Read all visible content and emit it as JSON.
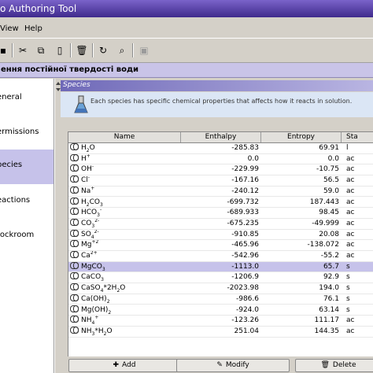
{
  "window": {
    "title": "o Authoring Tool"
  },
  "menu": [
    {
      "label": "View"
    },
    {
      "label": "Help"
    }
  ],
  "document_bar": {
    "title": "ення постійної твердості води"
  },
  "sidebar": {
    "items": [
      {
        "label": "eneral",
        "selected": false
      },
      {
        "label": "ermissions",
        "selected": false
      },
      {
        "label": "pecies",
        "selected": true
      },
      {
        "label": "eactions",
        "selected": false
      },
      {
        "label": "tockroom",
        "selected": false
      }
    ]
  },
  "section": {
    "title": "Species",
    "info": "Each species has specific chemical properties that affects how it reacts in solution."
  },
  "table": {
    "columns": [
      "Name",
      "Enthalpy",
      "Entropy",
      "Sta"
    ],
    "rows": [
      {
        "name": "H<sub>2</sub>O",
        "enthalpy": "-285.83",
        "entropy": "69.91",
        "state": "l"
      },
      {
        "name": "H<sup>+</sup>",
        "enthalpy": "0.0",
        "entropy": "0.0",
        "state": "ac"
      },
      {
        "name": "OH<sup>-</sup>",
        "enthalpy": "-229.99",
        "entropy": "-10.75",
        "state": "ac"
      },
      {
        "name": "Cl<sup>-</sup>",
        "enthalpy": "-167.16",
        "entropy": "56.5",
        "state": "ac"
      },
      {
        "name": "Na<sup>+</sup>",
        "enthalpy": "-240.12",
        "entropy": "59.0",
        "state": "ac"
      },
      {
        "name": "H<sub>2</sub>CO<sub>3</sub>",
        "enthalpy": "-699.732",
        "entropy": "187.443",
        "state": "ac"
      },
      {
        "name": "HCO<sub>3</sub><sup>-</sup>",
        "enthalpy": "-689.933",
        "entropy": "98.45",
        "state": "ac"
      },
      {
        "name": "CO<sub>3</sub><sup>2-</sup>",
        "enthalpy": "-675.235",
        "entropy": "-49.999",
        "state": "ac"
      },
      {
        "name": "SO<sub>4</sub><sup>2-</sup>",
        "enthalpy": "-910.85",
        "entropy": "20.08",
        "state": "ac"
      },
      {
        "name": "Mg<sup>+2</sup>",
        "enthalpy": "-465.96",
        "entropy": "-138.072",
        "state": "ac"
      },
      {
        "name": "Ca<sup>2+</sup>",
        "enthalpy": "-542.96",
        "entropy": "-55.2",
        "state": "ac"
      },
      {
        "name": "MgCO<sub>3</sub>",
        "enthalpy": "-1113.0",
        "entropy": "65.7",
        "state": "s"
      },
      {
        "name": "CaCO<sub>3</sub>",
        "enthalpy": "-1206.9",
        "entropy": "92.9",
        "state": "s"
      },
      {
        "name": "CaSO<sub>4</sub>*2H<sub>2</sub>O",
        "enthalpy": "-2023.98",
        "entropy": "194.0",
        "state": "s"
      },
      {
        "name": "Ca(OH)<sub>2</sub>",
        "enthalpy": "-986.6",
        "entropy": "76.1",
        "state": "s"
      },
      {
        "name": "Mg(OH)<sub>2</sub>",
        "enthalpy": "-924.0",
        "entropy": "63.14",
        "state": "s"
      },
      {
        "name": "NH<sub>4</sub><sup>+</sup>",
        "enthalpy": "-123.26",
        "entropy": "111.17",
        "state": "ac"
      },
      {
        "name": "NH<sub>3</sub>*H<sub>2</sub>O",
        "enthalpy": "251.04",
        "entropy": "144.35",
        "state": "ac"
      }
    ],
    "selected_row": "MgCO3"
  },
  "buttons": {
    "add": "Add",
    "modify": "Modify",
    "delete": "Delete"
  },
  "icons": {
    "toolbar": [
      "save-icon",
      "cut-icon",
      "copy-icon",
      "paste-icon",
      "delete-icon",
      "redo-icon",
      "search-icon",
      "disabled-icon"
    ]
  },
  "colors": {
    "selection": "#c6c2ea",
    "title_bar": "#3f2a8c",
    "section_header": "#6f69b8"
  }
}
